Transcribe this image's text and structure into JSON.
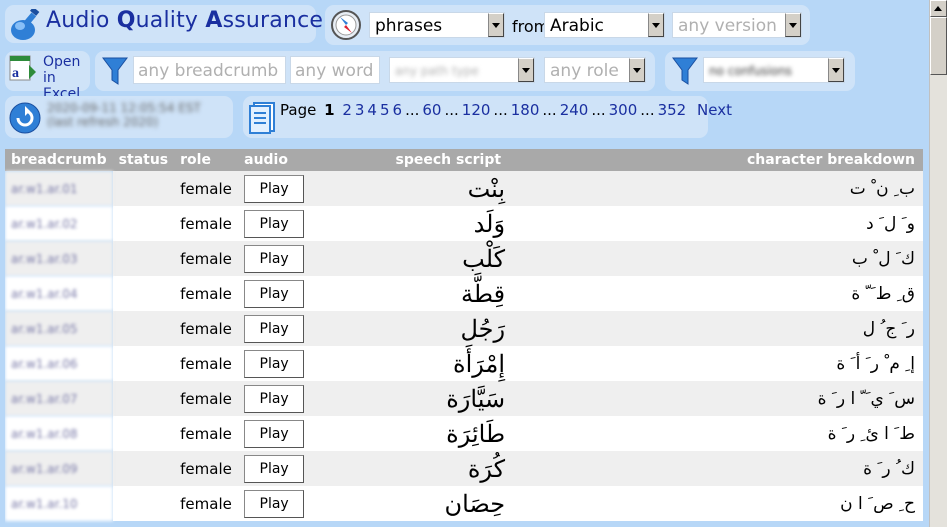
{
  "header": {
    "title_part1": "Audio ",
    "title_part2": "Q",
    "title_part3": "uality ",
    "title_part4": "A",
    "title_part5": "ssurance"
  },
  "selector": {
    "type_value": "phrases",
    "from_label": "from",
    "language_value": "Arabic",
    "version_placeholder": "any version"
  },
  "excel": {
    "line1": "Open",
    "line2": "in Excel"
  },
  "filters": {
    "breadcrumb_placeholder": "any breadcrumb",
    "word_placeholder": "any word",
    "path_type_placeholder": "any path type",
    "role_placeholder": "any role",
    "confusion_value": "no confusions"
  },
  "refresh": {
    "line1": "2020-09-11 12:05:54 EST",
    "line2": "(last refresh 2020)"
  },
  "pager": {
    "label": "Page",
    "current": "1",
    "pages": [
      "2",
      "3",
      "4",
      "5",
      "6",
      "...",
      "60",
      "...",
      "120",
      "...",
      "180",
      "...",
      "240",
      "...",
      "300",
      "...",
      "352"
    ],
    "next": "Next"
  },
  "table": {
    "headers": {
      "breadcrumb": "breadcrumb",
      "status": "status",
      "role": "role",
      "audio": "audio",
      "script": "speech script",
      "chars": "character breakdown"
    },
    "play_label": "Play",
    "rows": [
      {
        "breadcrumb": "ar.w1.ar.01",
        "role": "female",
        "script": "بِنْت",
        "chars": "ب ِ ن ْ ت"
      },
      {
        "breadcrumb": "ar.w1.ar.02",
        "role": "female",
        "script": "وَلَد",
        "chars": "و َ ل َ د"
      },
      {
        "breadcrumb": "ar.w1.ar.03",
        "role": "female",
        "script": "كَلْب",
        "chars": "ك َ ل ْ ب"
      },
      {
        "breadcrumb": "ar.w1.ar.04",
        "role": "female",
        "script": "قِطَّة",
        "chars": "ق ِ ط َ ّ ة"
      },
      {
        "breadcrumb": "ar.w1.ar.05",
        "role": "female",
        "script": "رَجُل",
        "chars": "ر َ ج ُ ل"
      },
      {
        "breadcrumb": "ar.w1.ar.06",
        "role": "female",
        "script": "إِمْرَأَة",
        "chars": "إ ِ م ْ ر َ أ َ ة"
      },
      {
        "breadcrumb": "ar.w1.ar.07",
        "role": "female",
        "script": "سَيَّارَة",
        "chars": "س َ ي َ ّ ا ر َ ة"
      },
      {
        "breadcrumb": "ar.w1.ar.08",
        "role": "female",
        "script": "طَائِرَة",
        "chars": "ط َ ا ئ ِ ر َ ة"
      },
      {
        "breadcrumb": "ar.w1.ar.09",
        "role": "female",
        "script": "كُرَة",
        "chars": "ك ُ ر َ ة"
      },
      {
        "breadcrumb": "ar.w1.ar.10",
        "role": "female",
        "script": "حِصَان",
        "chars": "ح ِ ص َ ا ن"
      }
    ]
  },
  "colors": {
    "background": "#b7d7f7",
    "panel": "#cfe3f8",
    "title": "#1a2fa0",
    "table_header": "#a9a9a9"
  }
}
